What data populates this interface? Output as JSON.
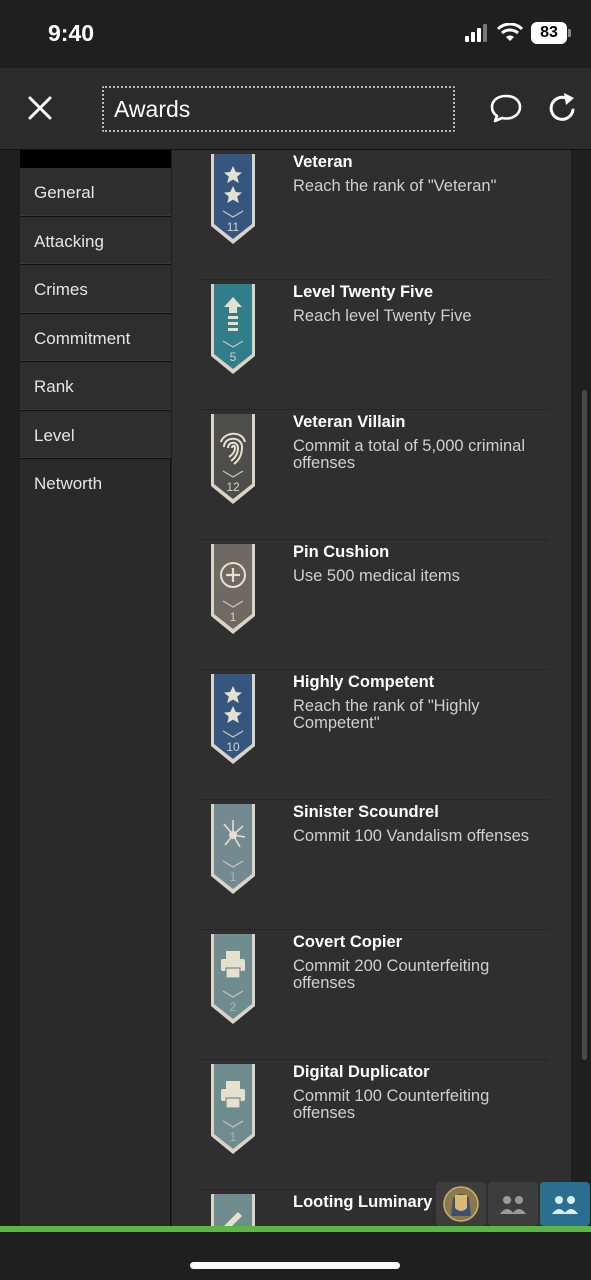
{
  "status": {
    "time": "9:40",
    "battery": "83"
  },
  "header": {
    "title": "Awards"
  },
  "sidebar": {
    "items": [
      {
        "label": "General"
      },
      {
        "label": "Attacking"
      },
      {
        "label": "Crimes"
      },
      {
        "label": "Commitment"
      },
      {
        "label": "Rank"
      },
      {
        "label": "Level"
      },
      {
        "label": "Networth"
      }
    ]
  },
  "awards": [
    {
      "name": "Veteran",
      "desc": "Reach the rank of \"Veteran\"",
      "medal_number": "11",
      "medal_icon": "two-stars-icon",
      "medal_color": "#35577f"
    },
    {
      "name": "Level Twenty Five",
      "desc": "Reach level Twenty Five",
      "medal_number": "5",
      "medal_icon": "level-up-arrow-icon",
      "medal_color": "#2f7e8a"
    },
    {
      "name": "Veteran Villain",
      "desc": "Commit a total of 5,000 criminal offenses",
      "medal_number": "12",
      "medal_icon": "fingerprint-icon",
      "medal_color": "#4d4d4a"
    },
    {
      "name": "Pin Cushion",
      "desc": "Use 500 medical items",
      "medal_number": "1",
      "medal_icon": "plus-circle-icon",
      "medal_color": "#6e6a61"
    },
    {
      "name": "Highly Competent",
      "desc": "Reach the rank of \"Highly Competent\"",
      "medal_number": "10",
      "medal_icon": "two-stars-icon",
      "medal_color": "#35577f"
    },
    {
      "name": "Sinister Scoundrel",
      "desc": "Commit 100 Vandalism offenses",
      "medal_number": "1",
      "medal_icon": "shattered-glass-icon",
      "medal_color": "#738a90"
    },
    {
      "name": "Covert Copier",
      "desc": "Commit 200 Counterfeiting offenses",
      "medal_number": "2",
      "medal_icon": "printer-icon",
      "medal_color": "#6f8c8f"
    },
    {
      "name": "Digital Duplicator",
      "desc": "Commit 100 Counterfeiting offenses",
      "medal_number": "1",
      "medal_icon": "printer-icon",
      "medal_color": "#6f8c8f"
    },
    {
      "name": "Looting Luminary",
      "desc": "",
      "medal_number": "",
      "medal_icon": "pen-icon",
      "medal_color": "#6f8c8f"
    }
  ],
  "tray": {
    "buttons": [
      "pharaoh-avatar-icon",
      "group-icon",
      "group-icon-active"
    ]
  }
}
